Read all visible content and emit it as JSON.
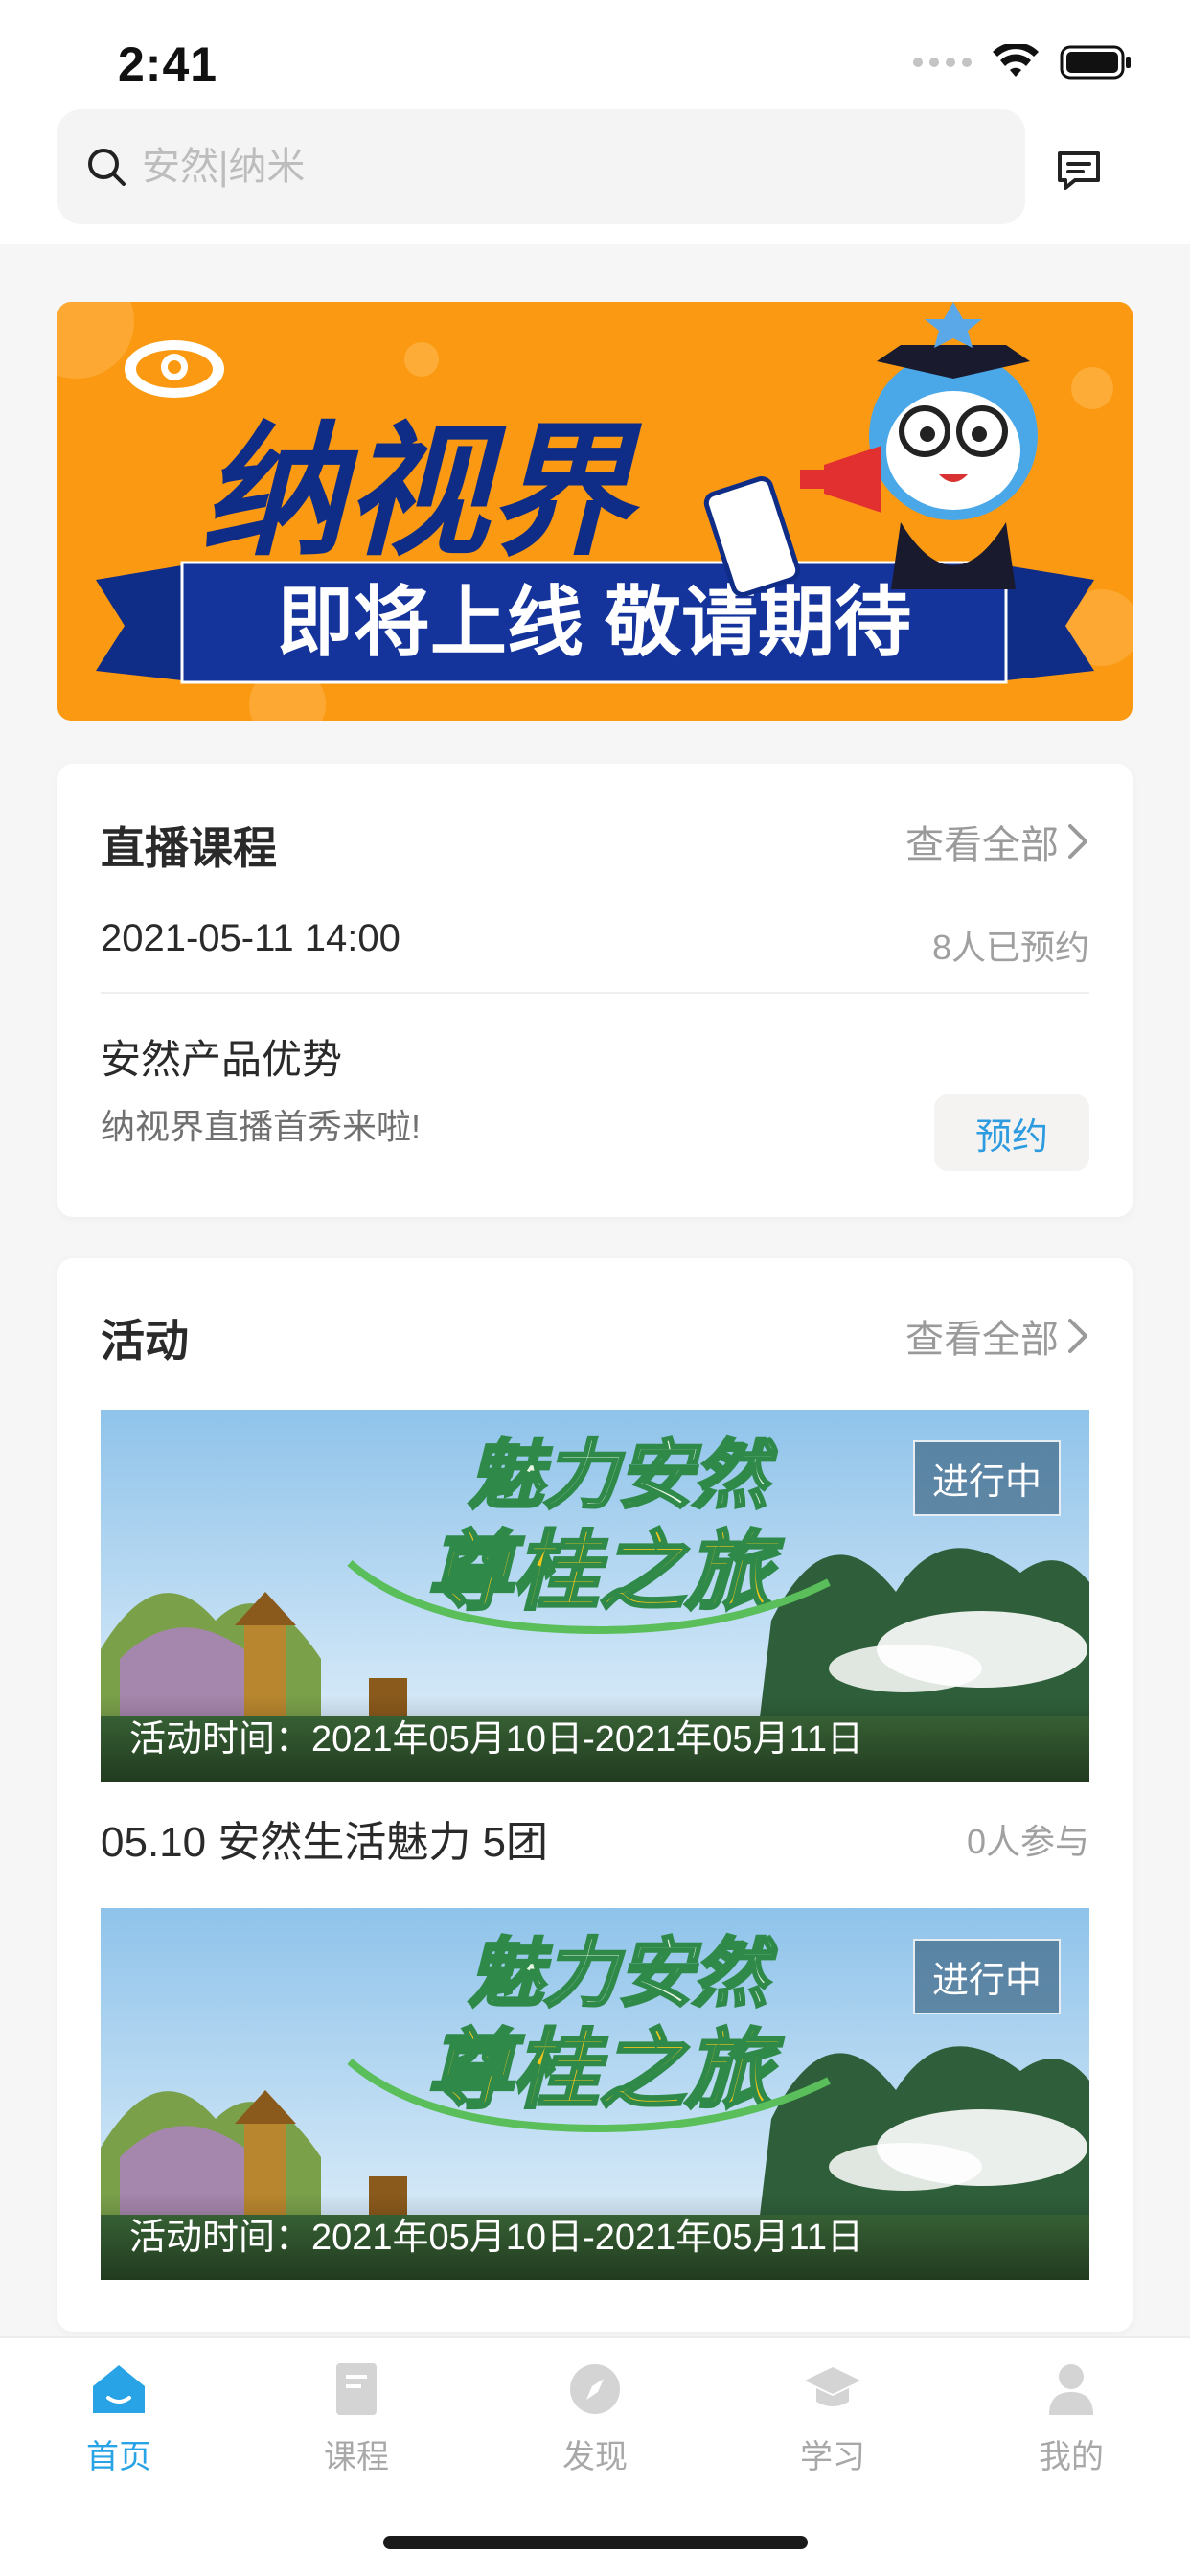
{
  "status_bar": {
    "time": "2:41"
  },
  "search": {
    "placeholder": "安然|纳米"
  },
  "banner": {
    "brand": "纳视界",
    "slogan": "即将上线 敬请期待"
  },
  "live_section": {
    "title": "直播课程",
    "view_all": "查看全部",
    "datetime": "2021-05-11 14:00",
    "booked": "8人已预约",
    "course_name": "安然产品优势",
    "course_desc": "纳视界直播首秀来啦!",
    "reserve_label": "预约"
  },
  "activity_section": {
    "title": "活动",
    "view_all": "查看全部",
    "items": [
      {
        "image_title_1": "魅力安然",
        "image_title_2": "尊桂之旅",
        "status": "进行中",
        "time": "活动时间：2021年05月10日-2021年05月11日",
        "name": "05.10 安然生活魅力 5团",
        "count": "0人参与"
      },
      {
        "image_title_1": "魅力安然",
        "image_title_2": "尊桂之旅",
        "status": "进行中",
        "time": "活动时间：2021年05月10日-2021年05月11日"
      }
    ]
  },
  "tab_bar": {
    "tabs": [
      {
        "label": "首页",
        "icon": "home-icon",
        "active": true
      },
      {
        "label": "课程",
        "icon": "book-icon",
        "active": false
      },
      {
        "label": "发现",
        "icon": "compass-icon",
        "active": false
      },
      {
        "label": "学习",
        "icon": "graduation-cap-icon",
        "active": false
      },
      {
        "label": "我的",
        "icon": "person-icon",
        "active": false
      }
    ]
  },
  "colors": {
    "accent": "#27a3e6",
    "banner_orange": "#fb9a12",
    "banner_navy": "#0f2c86"
  }
}
